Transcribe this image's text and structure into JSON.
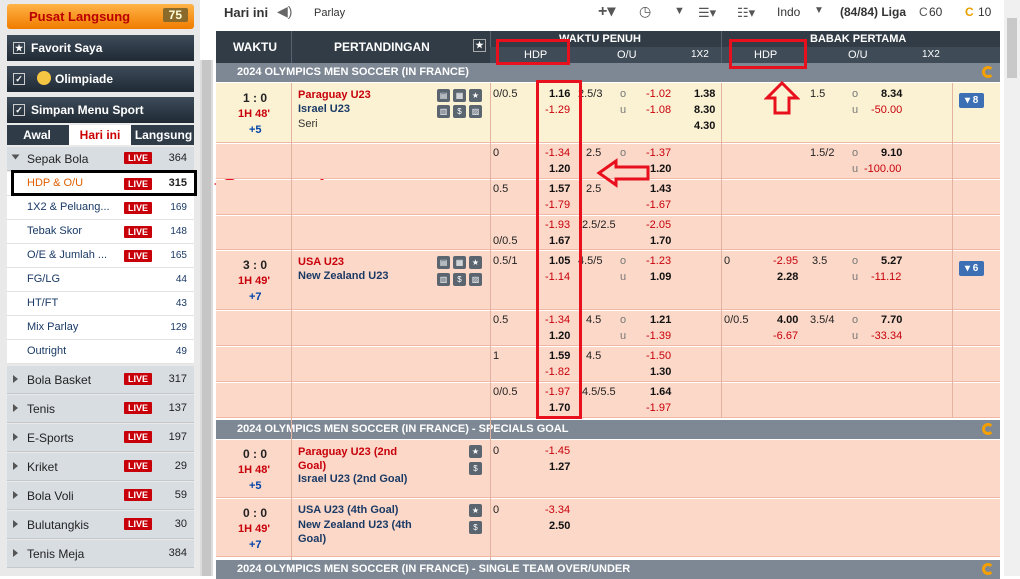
{
  "sidebar": {
    "live_center": {
      "label": "Pusat Langsung",
      "count": "75"
    },
    "favorites": "Favorit Saya",
    "olympics": "Olimpiade",
    "sports_menu": "Simpan Menu Sport",
    "tabs": [
      "Awal",
      "Hari ini",
      "Langsung"
    ],
    "live_label": "LIVE",
    "soccer": {
      "label": "Sepak Bola",
      "count": "364"
    },
    "sub_items": [
      {
        "label": "HDP & O/U",
        "count": "315",
        "live": true
      },
      {
        "label": "1X2 & Peluang...",
        "count": "169",
        "live": true
      },
      {
        "label": "Tebak Skor",
        "count": "148",
        "live": true
      },
      {
        "label": "O/E & Jumlah ...",
        "count": "165",
        "live": true
      },
      {
        "label": "FG/LG",
        "count": "44",
        "live": false
      },
      {
        "label": "HT/FT",
        "count": "43",
        "live": false
      },
      {
        "label": "Mix Parlay",
        "count": "129",
        "live": false
      },
      {
        "label": "Outright",
        "count": "49",
        "live": false
      }
    ],
    "sports": [
      {
        "label": "Bola Basket",
        "count": "317"
      },
      {
        "label": "Tenis",
        "count": "137"
      },
      {
        "label": "E-Sports",
        "count": "197"
      },
      {
        "label": "Kriket",
        "count": "29"
      },
      {
        "label": "Bola Voli",
        "count": "59"
      },
      {
        "label": "Bulutangkis",
        "count": "30"
      },
      {
        "label": "Tenis Meja",
        "count": "384"
      }
    ]
  },
  "toolbar": {
    "title": "Hari ini",
    "parlay": "Parlay",
    "odds_type": "Indo",
    "league": "(84/84) Liga",
    "c_value": "60",
    "coin_value": "10"
  },
  "header": {
    "waktu": "WAKTU",
    "pertandingan": "PERTANDINGAN",
    "full_time": "WAKTU PENUH",
    "first_half": "BABAK PERTAMA",
    "hdp": "HDP",
    "ou": "O/U",
    "x12": "1X2"
  },
  "sections": [
    "2024 OLYMPICS MEN SOCCER (IN FRANCE)",
    "2024 OLYMPICS MEN SOCCER (IN FRANCE) - SPECIALS GOAL",
    "2024 OLYMPICS MEN SOCCER (IN FRANCE) - SINGLE TEAM OVER/UNDER"
  ],
  "matches": [
    {
      "score": "1 : 0",
      "time": "1H 48'",
      "more": "+5",
      "home": "Paraguay U23",
      "away": "Israel U23",
      "draw": "Seri",
      "badge": "▾ 8",
      "lines": [
        {
          "hdp": "0/0.5",
          "h1": "1.16",
          "h2": "-1.29",
          "ou": "2.5/3",
          "o1": "-1.02",
          "o2": "-1.08",
          "x1": "1.38",
          "x2": "8.30",
          "x3": "4.30",
          "fh_hdp": "",
          "fh1": "",
          "fh2": "",
          "fh_ou": "1.5",
          "fo1": "8.34",
          "fo2": "-50.00"
        },
        {
          "hdp": "0",
          "h1": "-1.34",
          "h2": "1.20",
          "ou": "2.5",
          "o1": "-1.37",
          "o2": "1.20",
          "fh_hdp": "",
          "fh1": "",
          "fh2": "",
          "fh_ou": "1.5/2",
          "fo1": "9.10",
          "fo2": "-100.00"
        },
        {
          "hdp": "0.5",
          "h1": "1.57",
          "h2": "-1.79",
          "ou": "2.5",
          "o1": "1.43",
          "o2": "-1.67"
        },
        {
          "hdp": "0/0.5",
          "h1": "-1.93",
          "h2": "1.67",
          "ou": "2.5/2.5",
          "o1": "-2.05",
          "o2": "1.70"
        }
      ]
    },
    {
      "score": "3 : 0",
      "time": "1H 49'",
      "more": "+7",
      "home": "USA U23",
      "away": "New Zealand U23",
      "badge": "▾ 6",
      "lines": [
        {
          "hdp": "0.5/1",
          "h1": "1.05",
          "h2": "-1.14",
          "ou": "4.5/5",
          "o1": "-1.23",
          "o2": "1.09",
          "fh_hdp": "0",
          "fh1": "-2.95",
          "fh2": "2.28",
          "fh_ou": "3.5",
          "fo1": "5.27",
          "fo2": "-11.12"
        },
        {
          "hdp": "0.5",
          "h1": "-1.34",
          "h2": "1.20",
          "ou": "4.5",
          "o1": "1.21",
          "o2": "-1.39",
          "fh_hdp": "0/0.5",
          "fh1": "4.00",
          "fh2": "-6.67",
          "fh_ou": "3.5/4",
          "fo1": "7.70",
          "fo2": "-33.34"
        },
        {
          "hdp": "1",
          "h1": "1.59",
          "h2": "-1.82",
          "ou": "4.5",
          "o1": "-1.50",
          "o2": "1.30"
        },
        {
          "hdp": "0/0.5",
          "h1": "-1.97",
          "h2": "1.70",
          "ou": "4.5/5.5",
          "o1": "1.64",
          "o2": "-1.97"
        }
      ]
    }
  ],
  "specials": [
    {
      "score": "0 : 0",
      "time": "1H 48'",
      "more": "+5",
      "home": "Paraguay U23 (2nd Goal)",
      "away": "Israel U23 (2nd Goal)",
      "hdp": "0",
      "h1": "-1.45",
      "h2": "1.27"
    },
    {
      "score": "0 : 0",
      "time": "1H 49'",
      "more": "+7",
      "home": "USA U23 (4th Goal)",
      "away": "New Zealand U23 (4th Goal)",
      "hdp": "0",
      "h1": "-3.34",
      "h2": "2.50"
    }
  ]
}
